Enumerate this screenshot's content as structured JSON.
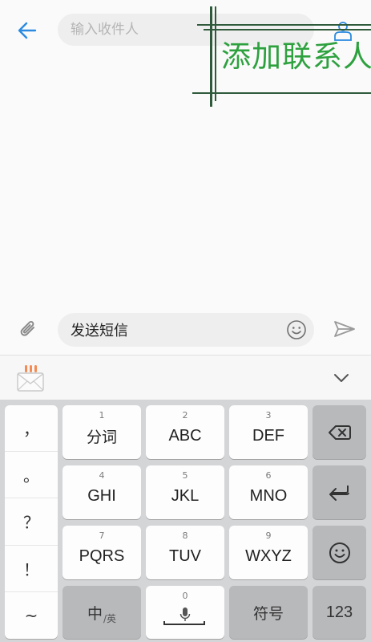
{
  "header": {
    "recipient_placeholder": "输入收件人"
  },
  "overlay": {
    "add_contact_label": "添加联系人"
  },
  "compose": {
    "message_value": "发送短信"
  },
  "keyboard": {
    "punctuation": [
      "，",
      "。",
      "？",
      "！",
      "~"
    ],
    "keys": [
      {
        "num": "1",
        "label": "分词"
      },
      {
        "num": "2",
        "label": "ABC"
      },
      {
        "num": "3",
        "label": "DEF"
      },
      {
        "num": "4",
        "label": "GHI"
      },
      {
        "num": "5",
        "label": "JKL"
      },
      {
        "num": "6",
        "label": "MNO"
      },
      {
        "num": "7",
        "label": "PQRS"
      },
      {
        "num": "8",
        "label": "TUV"
      },
      {
        "num": "9",
        "label": "WXYZ"
      }
    ],
    "lang_key": {
      "main": "中",
      "sub": "/英"
    },
    "space_key_num": "0",
    "symbols_label": "符号",
    "numbers_label": "123"
  },
  "colors": {
    "accent_blue": "#2b8be0",
    "overlay_green": "#2ea13f",
    "overlay_frame": "#2f5a3b"
  },
  "icons": {
    "back": "arrow-left-icon",
    "contact": "person-icon",
    "attach": "paperclip-icon",
    "emoji": "smiley-icon",
    "send": "paper-plane-icon",
    "ime_logo": "envelope-icon",
    "collapse": "chevron-down-icon",
    "backspace": "backspace-icon",
    "enter": "enter-icon",
    "voice": "microphone-icon"
  }
}
